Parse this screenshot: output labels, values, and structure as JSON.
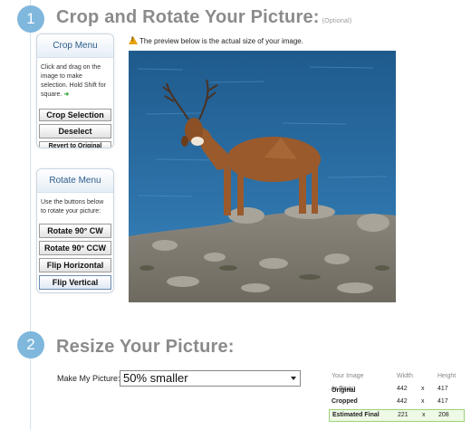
{
  "step1": {
    "number": "1",
    "title": "Crop and Rotate Your Picture:",
    "optional": "(Optional)"
  },
  "crop_menu": {
    "title": "Crop Menu",
    "description": "Click and drag on the image to make selection. Hold Shift for square.",
    "buttons": [
      "Crop Selection",
      "Deselect",
      "Revert to Original"
    ]
  },
  "rotate_menu": {
    "title": "Rotate Menu",
    "description": "Use the buttons below to rotate your picture:",
    "buttons": [
      "Rotate 90° CW",
      "Rotate 90° CCW",
      "Flip Horizontal",
      "Flip Vertical"
    ]
  },
  "preview_note": "The preview below is the actual size of your image.",
  "step2": {
    "number": "2",
    "title": "Resize Your Picture:"
  },
  "resize": {
    "label": "Make My Picture:",
    "selected": "50% smaller"
  },
  "dimensions": {
    "headers": [
      "Your Image",
      "Width",
      "Height"
    ],
    "rows": [
      {
        "label": "Original",
        "note": "(in Pixels)",
        "width": "442",
        "x": "x",
        "height": "417"
      },
      {
        "label": "Cropped",
        "note": "",
        "width": "442",
        "x": "x",
        "height": "417"
      },
      {
        "label": "Estimated Final",
        "note": "",
        "width": "221",
        "x": "x",
        "height": "208"
      }
    ]
  },
  "colors": {
    "accent": "#7fb7dd",
    "final_border": "#9bd37a"
  }
}
